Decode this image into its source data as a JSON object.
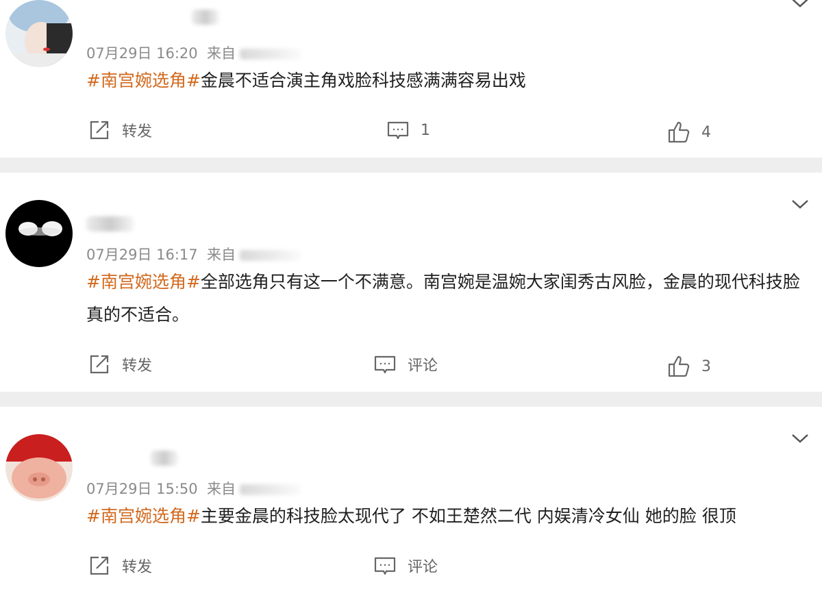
{
  "posts": [
    {
      "time": "07月29日 16:20",
      "from": "来自",
      "hashtag": "#南宫婉选角#",
      "text": "金晨不适合演主角戏脸科技感满满容易出戏",
      "repost_label": "转发",
      "comment_label": "1",
      "like_count": "4"
    },
    {
      "time": "07月29日 16:17",
      "from": "来自",
      "hashtag": "#南宫婉选角#",
      "text": "全部选角只有这一个不满意。南宫婉是温婉大家闺秀古风脸，金晨的现代科技脸真的不适合。",
      "repost_label": "转发",
      "comment_label": "评论",
      "like_count": "3"
    },
    {
      "time": "07月29日 15:50",
      "from": "来自",
      "hashtag": "#南宫婉选角#",
      "text": "主要金晨的科技脸太现代了 不如王楚然二代 内娱清冷女仙 她的脸 很顶",
      "repost_label": "转发",
      "comment_label": "评论"
    }
  ],
  "colors": {
    "hashtag": "#d2691e",
    "meta": "#8a8a8a",
    "separator": "#eeeeee"
  },
  "icons": {
    "repost": "repost-icon",
    "comment": "comment-icon",
    "like": "thumbs-up-icon",
    "expand": "chevron-down-icon"
  }
}
